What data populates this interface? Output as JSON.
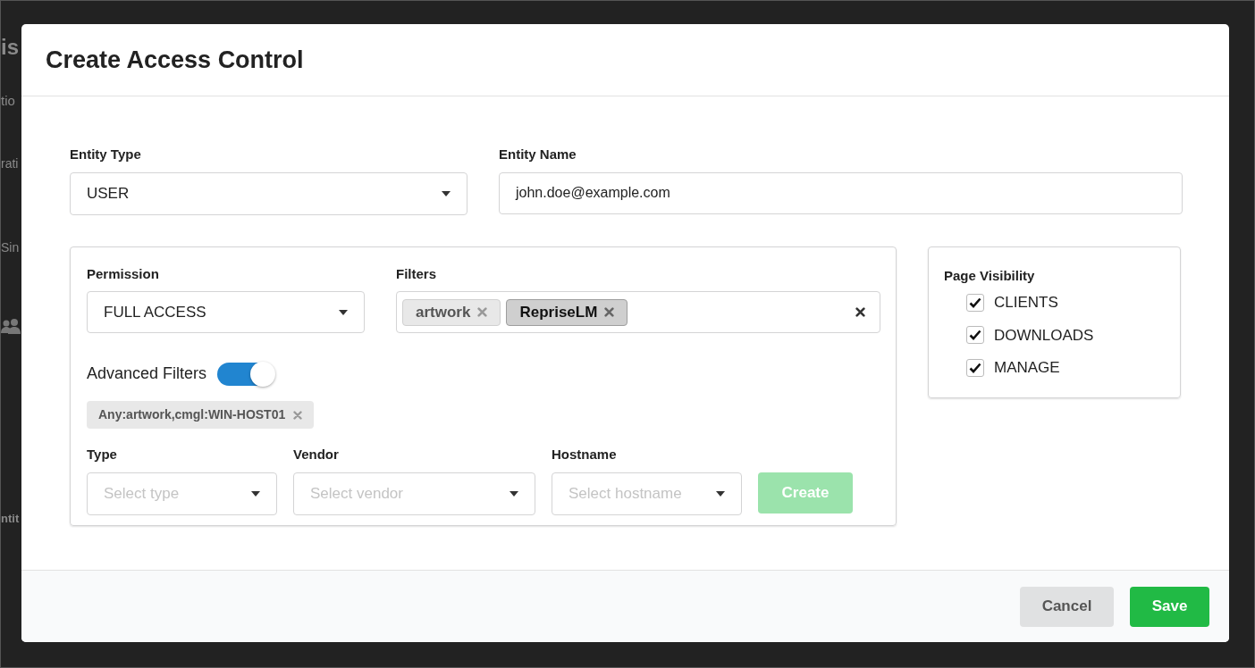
{
  "background": {
    "fragments": [
      {
        "text": "is",
        "kind": "heading"
      },
      {
        "text": "tio",
        "kind": "sub"
      },
      {
        "text": "rati",
        "kind": "row"
      },
      {
        "text": "Sin",
        "kind": "row"
      },
      {
        "text": "ntit",
        "kind": "strong"
      }
    ]
  },
  "dialog": {
    "title": "Create Access Control"
  },
  "entity_type": {
    "label": "Entity Type",
    "value": "USER"
  },
  "entity_name": {
    "label": "Entity Name",
    "value": "john.doe@example.com"
  },
  "permission": {
    "label": "Permission",
    "value": "FULL ACCESS"
  },
  "filters": {
    "label": "Filters",
    "tags": [
      {
        "text": "artwork",
        "selected": false
      },
      {
        "text": "RepriseLM",
        "selected": true
      }
    ]
  },
  "advanced_filters": {
    "label": "Advanced Filters",
    "on": true,
    "tags": [
      "Any:artwork,cmgl:WIN-HOST01"
    ]
  },
  "advanced_fields": [
    {
      "label": "Type",
      "placeholder": "Select type"
    },
    {
      "label": "Vendor",
      "placeholder": "Select vendor"
    },
    {
      "label": "Hostname",
      "placeholder": "Select hostname"
    }
  ],
  "create_button": {
    "label": "Create",
    "disabled": true
  },
  "page_visibility": {
    "title": "Page Visibility",
    "items": [
      {
        "label": "CLIENTS",
        "checked": true
      },
      {
        "label": "DOWNLOADS",
        "checked": true
      },
      {
        "label": "MANAGE",
        "checked": true
      }
    ]
  },
  "buttons": [
    {
      "label": "Cancel",
      "kind": "secondary"
    },
    {
      "label": "Save",
      "kind": "primary"
    }
  ]
}
